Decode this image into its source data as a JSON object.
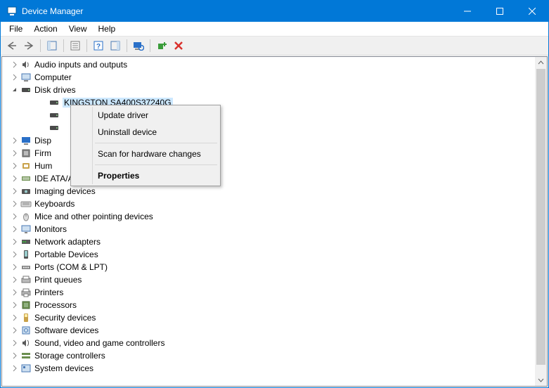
{
  "window": {
    "title": "Device Manager"
  },
  "menubar": {
    "file": "File",
    "action": "Action",
    "view": "View",
    "help": "Help"
  },
  "tree": {
    "items": [
      {
        "label": "Audio inputs and outputs",
        "expanded": false,
        "icon": "speaker"
      },
      {
        "label": "Computer",
        "expanded": false,
        "icon": "computer"
      },
      {
        "label": "Disk drives",
        "expanded": true,
        "icon": "disk",
        "children": [
          {
            "label": "KINGSTON SA400S37240G",
            "selected": true,
            "icon": "disk"
          },
          {
            "label": "",
            "icon": "disk"
          },
          {
            "label": "",
            "icon": "disk"
          }
        ]
      },
      {
        "label": "Disp",
        "expanded": false,
        "icon": "display",
        "truncated": true
      },
      {
        "label": "Firm",
        "expanded": false,
        "icon": "firmware",
        "truncated": true
      },
      {
        "label": "Hum",
        "expanded": false,
        "icon": "hid",
        "truncated": true
      },
      {
        "label": "IDE ATA/ATAPI controllers",
        "expanded": false,
        "icon": "ide"
      },
      {
        "label": "Imaging devices",
        "expanded": false,
        "icon": "imaging"
      },
      {
        "label": "Keyboards",
        "expanded": false,
        "icon": "keyboard"
      },
      {
        "label": "Mice and other pointing devices",
        "expanded": false,
        "icon": "mouse"
      },
      {
        "label": "Monitors",
        "expanded": false,
        "icon": "monitor"
      },
      {
        "label": "Network adapters",
        "expanded": false,
        "icon": "network"
      },
      {
        "label": "Portable Devices",
        "expanded": false,
        "icon": "portable"
      },
      {
        "label": "Ports (COM & LPT)",
        "expanded": false,
        "icon": "ports"
      },
      {
        "label": "Print queues",
        "expanded": false,
        "icon": "printqueue"
      },
      {
        "label": "Printers",
        "expanded": false,
        "icon": "printer"
      },
      {
        "label": "Processors",
        "expanded": false,
        "icon": "cpu"
      },
      {
        "label": "Security devices",
        "expanded": false,
        "icon": "security"
      },
      {
        "label": "Software devices",
        "expanded": false,
        "icon": "software"
      },
      {
        "label": "Sound, video and game controllers",
        "expanded": false,
        "icon": "sound"
      },
      {
        "label": "Storage controllers",
        "expanded": false,
        "icon": "storage"
      },
      {
        "label": "System devices",
        "expanded": false,
        "icon": "system",
        "cut": true
      }
    ]
  },
  "context_menu": {
    "update": "Update driver",
    "uninstall": "Uninstall device",
    "scan": "Scan for hardware changes",
    "properties": "Properties"
  }
}
